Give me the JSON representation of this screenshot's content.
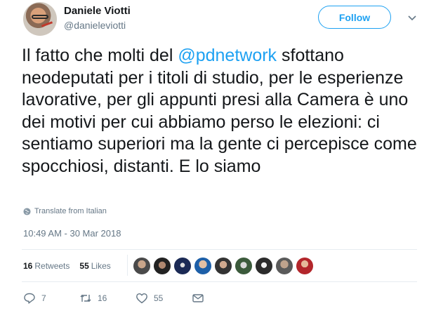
{
  "author": {
    "display_name": "Daniele Viotti",
    "screen_name": "@danieleviotti"
  },
  "follow_label": "Follow",
  "tweet": {
    "text_before": "Il fatto che molti del ",
    "mention": "@pdnetwork",
    "text_after": " sfottano neodeputati per i titoli di studio, per le esperienze lavorative, per gli appunti presi alla Camera è uno dei motivi per cui abbiamo perso le elezioni: ci sentiamo superiori ma la gente ci percepisce come spocchiosi, distanti. E lo siamo"
  },
  "translate_label": "Translate from Italian",
  "timestamp": "10:49 AM - 30 Mar 2018",
  "stats": {
    "retweets_count": "16",
    "retweets_label": "Retweets",
    "likes_count": "55",
    "likes_label": "Likes"
  },
  "actions": {
    "replies": "7",
    "retweets": "16",
    "likes": "55"
  },
  "colors": {
    "accent": "#1da1f2",
    "secondary_text": "#657786",
    "divider": "#e6ecf0"
  },
  "icons": [
    "globe-icon",
    "reply-icon",
    "retweet-icon",
    "like-icon",
    "dm-icon",
    "caret-down-icon"
  ]
}
